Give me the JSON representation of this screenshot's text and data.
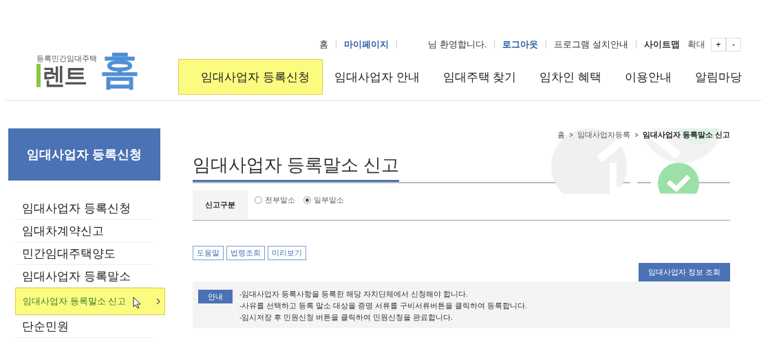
{
  "logo": {
    "tagline": "등록민간임대주택",
    "word": "렌트",
    "home": "홈"
  },
  "top_links": [
    {
      "label": "홈",
      "kind": "plain"
    },
    {
      "label": "마이페이지",
      "kind": "blue"
    },
    {
      "label": "님 환영합니다.",
      "kind": "greeting"
    },
    {
      "label": "로그아웃",
      "kind": "blue"
    },
    {
      "label": "프로그램 설치안내",
      "kind": "plain"
    },
    {
      "label": "사이트맵",
      "kind": "bold"
    }
  ],
  "zoom": {
    "label": "확대",
    "plus": "+",
    "minus": "-"
  },
  "nav": [
    {
      "label": "임대사업자 등록신청",
      "selected": true
    },
    {
      "label": "임대사업자 안내",
      "selected": false
    },
    {
      "label": "임대주택 찾기",
      "selected": false
    },
    {
      "label": "임차인 혜택",
      "selected": false
    },
    {
      "label": "이용안내",
      "selected": false
    },
    {
      "label": "알림마당",
      "selected": false
    }
  ],
  "sidebar": {
    "title": "임대사업자 등록신청",
    "items": [
      {
        "label": "임대사업자 등록신청",
        "selected": false
      },
      {
        "label": "임대차계약신고",
        "selected": false
      },
      {
        "label": "민간임대주택양도",
        "selected": false
      },
      {
        "label": "임대사업자 등록말소",
        "selected": false
      },
      {
        "label": "임대사업자 등록말소 신고",
        "selected": true
      },
      {
        "label": "단순민원",
        "selected": false
      }
    ]
  },
  "breadcrumb": [
    "홈",
    "임대사업자등록",
    "임대사업자 등록말소 신고"
  ],
  "page_title": "임대사업자 등록말소 신고",
  "form": {
    "label": "신고구분",
    "options": [
      {
        "label": "전부말소",
        "selected": false
      },
      {
        "label": "일부말소",
        "selected": true
      }
    ]
  },
  "tool_buttons": [
    "도움말",
    "법령조회",
    "미리보기"
  ],
  "lookup_button": "임대사업자 정보 조회",
  "notice": {
    "badge": "안내",
    "lines": [
      "-임대사업자 등록사항을 등록한 해당 자치단체에서 신청해야 합니다.",
      "-사유를 선택하고 등록 말소 대상을 증명 서류를 구비서류버튼을 클릭하여 등록합니다.",
      "-임시저장 후 민원신청 버튼을 클릭하여 민원신청을 완료합니다."
    ]
  }
}
